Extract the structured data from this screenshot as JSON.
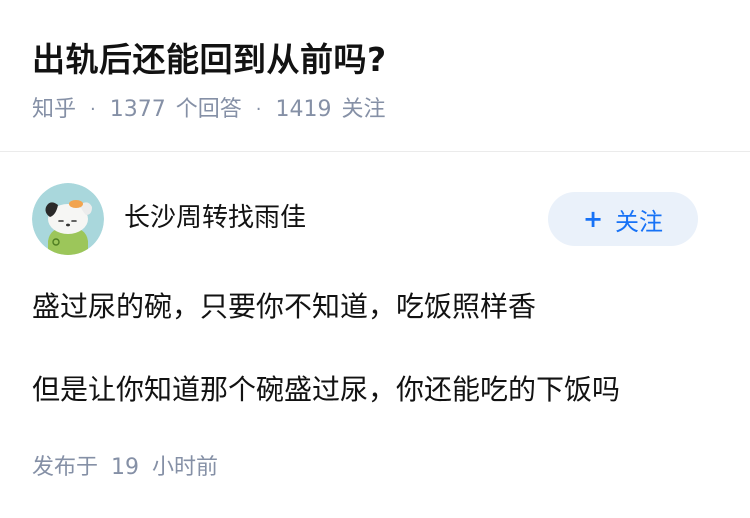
{
  "question": {
    "title": "出轨后还能回到从前吗?",
    "meta": {
      "source": "知乎",
      "separator": "·",
      "answer_count": "1377",
      "answer_label": "个回答",
      "follower_count": "1419",
      "follower_label": "关注"
    }
  },
  "answer": {
    "author": {
      "name": "长沙周转找雨佳",
      "avatar_icon": "cartoon-dog-avatar"
    },
    "follow_button": {
      "icon": "plus-icon",
      "plus": "+",
      "label": "关注"
    },
    "content": [
      "盛过尿的碗，只要你不知道，吃饭照样香",
      "但是让你知道那个碗盛过尿，你还能吃的下饭吗"
    ],
    "time": {
      "prefix": "发布于",
      "value": "19",
      "suffix": "小时前"
    }
  },
  "colors": {
    "title": "#121212",
    "meta": "#8590a6",
    "follow_bg": "#eaf1fa",
    "follow_text": "#1772f6",
    "divider": "#ebebeb"
  }
}
